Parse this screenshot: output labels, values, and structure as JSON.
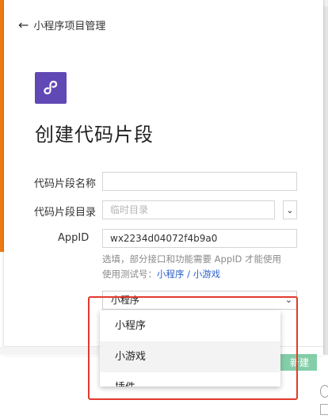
{
  "nav": {
    "back_label": "小程序项目管理"
  },
  "dialog": {
    "title": "创建代码片段"
  },
  "form": {
    "name_label": "代码片段名称",
    "name_value": "",
    "dir_label": "代码片段目录",
    "dir_placeholder": "临时目录",
    "appid_label": "AppID",
    "appid_value": "wx2234d04072f4b9a0",
    "hint_line1": "选填，部分接口和功能需要 AppID 才能使用",
    "hint_line2_prefix": "使用测试号：",
    "hint_link_miniprogram": "小程序",
    "hint_separator": " / ",
    "hint_link_minigame": "小游戏",
    "type_selected": "小程序"
  },
  "dropdown": {
    "options": [
      "小程序",
      "小游戏",
      "插件"
    ]
  },
  "footer": {
    "create_label": "新建"
  },
  "colors": {
    "accent_green": "#21a963",
    "logo_purple": "#6048b5",
    "link_blue": "#2a5fc7",
    "highlight_red": "#e23a2e",
    "window_orange": "#f07a12"
  }
}
